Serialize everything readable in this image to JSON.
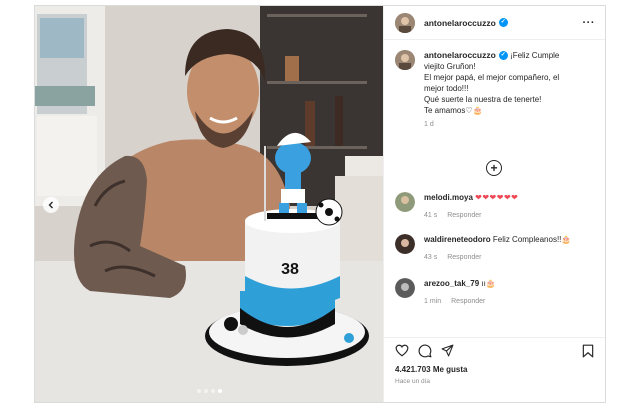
{
  "post": {
    "username": "antonelaroccuzzo",
    "caption_lines": [
      "¡Feliz Cumple",
      "viejito Gruñon!",
      "El mejor papá, el mejor compañero, el",
      "mejor todo!!!",
      "Qué suerte la nuestra de tenerte!",
      "Te amamos♡🎂"
    ],
    "age": "1 d",
    "likes": "4.421.703 Me gusta",
    "when": "Hace un día",
    "cake_number": "38",
    "carousel": {
      "count": 4,
      "active": 3
    }
  },
  "comments": [
    {
      "user": "melodi.moya",
      "text": "❤❤❤❤❤❤",
      "time": "41 s",
      "reply": "Responder",
      "avatar_color": "#8f9a7a"
    },
    {
      "user": "waldireneteodoro",
      "text": "Feliz Compleanos!!🎂",
      "time": "43 s",
      "reply": "Responder",
      "avatar_color": "#3c2f2a"
    },
    {
      "user": "arezoo_tak_79",
      "text": "ıı🎂",
      "time": "1 min",
      "reply": "Responder",
      "avatar_color": "#5b5b5b"
    }
  ],
  "icons": {
    "header_more": "more-options-icon",
    "add_comment": "plus-circle-icon",
    "like": "heart-icon",
    "comment": "comment-icon",
    "share": "share-icon",
    "save": "bookmark-icon"
  },
  "colors": {
    "verified": "#0095f6",
    "heart": "#ed4956",
    "muted": "#8e8e8e"
  }
}
